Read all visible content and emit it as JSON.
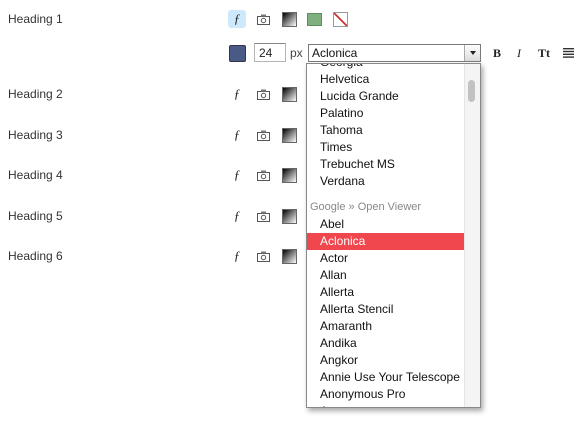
{
  "headings": [
    {
      "label": "Heading 1"
    },
    {
      "label": "Heading 2"
    },
    {
      "label": "Heading 3"
    },
    {
      "label": "Heading 4"
    },
    {
      "label": "Heading 5"
    },
    {
      "label": "Heading 6"
    }
  ],
  "icons": {
    "font": "font-icon",
    "camera": "camera-icon",
    "gradient": "gradient-icon",
    "color": "color-swatch-icon",
    "none": "no-color-icon",
    "font_glyph": "ƒ"
  },
  "editor": {
    "swatch_color": "#4a5a86",
    "size_value": "24",
    "size_unit": "px",
    "selected_font": "Aclonica",
    "bold_label": "B",
    "italic_label": "I",
    "case_label": "Tt",
    "align_icon": "align-justify-icon"
  },
  "dropdown": {
    "items": [
      {
        "type": "item",
        "label": "Georgia"
      },
      {
        "type": "item",
        "label": "Helvetica"
      },
      {
        "type": "item",
        "label": "Lucida Grande"
      },
      {
        "type": "item",
        "label": "Palatino"
      },
      {
        "type": "item",
        "label": "Tahoma"
      },
      {
        "type": "item",
        "label": "Times"
      },
      {
        "type": "item",
        "label": "Trebuchet MS"
      },
      {
        "type": "item",
        "label": "Verdana"
      },
      {
        "type": "spacer"
      },
      {
        "type": "group",
        "label": "Google » Open Viewer"
      },
      {
        "type": "item",
        "label": "Abel"
      },
      {
        "type": "item",
        "label": "Aclonica",
        "selected": true
      },
      {
        "type": "item",
        "label": "Actor"
      },
      {
        "type": "item",
        "label": "Allan"
      },
      {
        "type": "item",
        "label": "Allerta"
      },
      {
        "type": "item",
        "label": "Allerta Stencil"
      },
      {
        "type": "item",
        "label": "Amaranth"
      },
      {
        "type": "item",
        "label": "Andika"
      },
      {
        "type": "item",
        "label": "Angkor"
      },
      {
        "type": "item",
        "label": "Annie Use Your Telescope"
      },
      {
        "type": "item",
        "label": "Anonymous Pro"
      },
      {
        "type": "item",
        "label": "Anton"
      }
    ]
  },
  "colors": {
    "selection": "#f0474f",
    "active_icon_bg": "#cde9fb",
    "swatch_green": "#7fb07f"
  }
}
